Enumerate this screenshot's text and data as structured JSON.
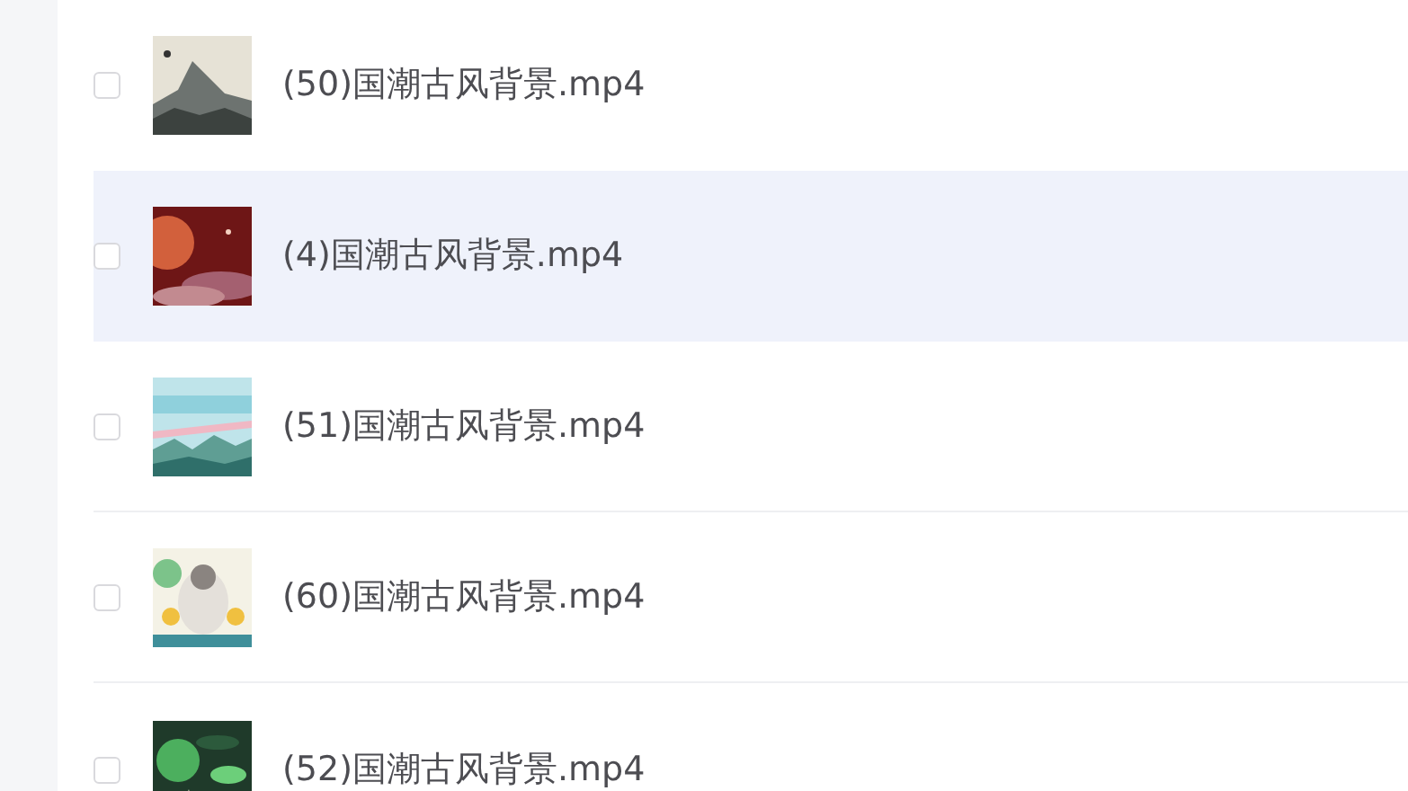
{
  "files": [
    {
      "name": "(50)国潮古风背景.mp4",
      "checked": false,
      "hovered": false
    },
    {
      "name": "(4)国潮古风背景.mp4",
      "checked": false,
      "hovered": true
    },
    {
      "name": "(51)国潮古风背景.mp4",
      "checked": false,
      "hovered": false
    },
    {
      "name": "(60)国潮古风背景.mp4",
      "checked": false,
      "hovered": false
    },
    {
      "name": "(52)国潮古风背景.mp4",
      "checked": false,
      "hovered": false
    }
  ]
}
